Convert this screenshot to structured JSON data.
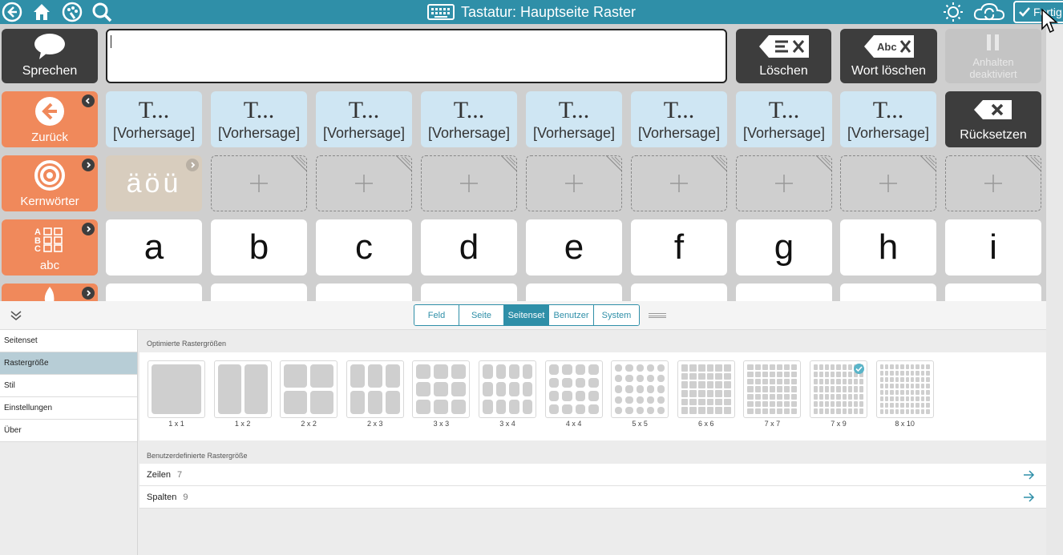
{
  "topbar": {
    "title": "Tastatur: Hauptseite Raster",
    "done_label": "Fertig",
    "icons": [
      "back-icon",
      "home-icon",
      "palette-icon",
      "search-icon",
      "brightness-icon",
      "cloud-sync-icon"
    ]
  },
  "actions": {
    "speak_label": "Sprechen",
    "delete_label": "Löschen",
    "delete_word_label": "Wort löschen",
    "delete_word_icon_text": "Abc",
    "pause_label_1": "Anhalten",
    "pause_label_2": "deaktiviert",
    "reset_label": "Rücksetzen"
  },
  "sidebar_buttons": [
    {
      "label": "Zurück"
    },
    {
      "label": "Kernwörter"
    },
    {
      "label": "abc",
      "icon_text": "ABC"
    }
  ],
  "predictions": {
    "big": "T...",
    "small": "[Vorhersage]",
    "count": 8
  },
  "umlaut_key": "äöü",
  "letters": [
    "a",
    "b",
    "c",
    "d",
    "e",
    "f",
    "g",
    "h",
    "i"
  ],
  "panel": {
    "tabs": [
      "Feld",
      "Seite",
      "Seitenset",
      "Benutzer",
      "System"
    ],
    "active_tab": "Seitenset",
    "menu": [
      "Seitenset",
      "Rastergröße",
      "Stil",
      "Einstellungen",
      "Über"
    ],
    "selected_menu": "Rastergröße",
    "optimized_title": "Optimierte Rastergrößen",
    "grid_options": [
      {
        "label": "1 x 1",
        "rows": 1,
        "cols": 1
      },
      {
        "label": "1 x 2",
        "rows": 1,
        "cols": 2
      },
      {
        "label": "2 x 2",
        "rows": 2,
        "cols": 2
      },
      {
        "label": "2 x 3",
        "rows": 2,
        "cols": 3
      },
      {
        "label": "3 x 3",
        "rows": 3,
        "cols": 3
      },
      {
        "label": "3 x 4",
        "rows": 3,
        "cols": 4
      },
      {
        "label": "4 x 4",
        "rows": 4,
        "cols": 4
      },
      {
        "label": "5 x 5",
        "rows": 5,
        "cols": 5
      },
      {
        "label": "6 x 6",
        "rows": 6,
        "cols": 6
      },
      {
        "label": "7 x 7",
        "rows": 7,
        "cols": 7
      },
      {
        "label": "7 x 9",
        "rows": 7,
        "cols": 9,
        "selected": true
      },
      {
        "label": "8 x 10",
        "rows": 8,
        "cols": 10
      }
    ],
    "custom_title": "Benutzerdefinierte Rastergröße",
    "rows_label": "Zeilen",
    "rows_value": "7",
    "cols_label": "Spalten",
    "cols_value": "9"
  },
  "colors": {
    "accent": "#2f8fa8",
    "side_button": "#f0895b",
    "prediction": "#cfe6f3",
    "dark_button": "#3d3d3d"
  }
}
